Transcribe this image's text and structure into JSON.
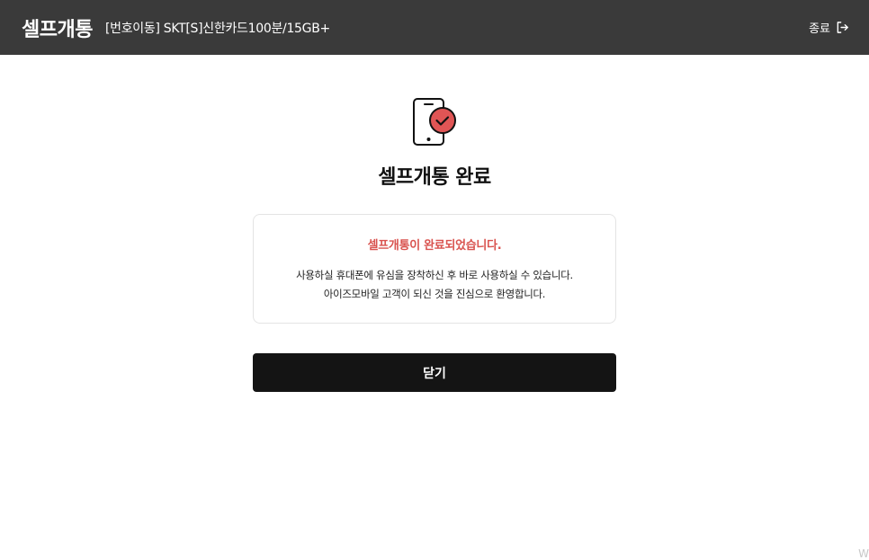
{
  "header": {
    "brand": "셀프개통",
    "plan": "[번호이동] SKT[S]신한카드100분/15GB+",
    "exit_label": "종료"
  },
  "main": {
    "icon": "phone-check-icon",
    "title": "셀프개통 완료",
    "card": {
      "headline": "셀프개통이 완료되었습니다.",
      "line1": "사용하실 휴대폰에 유심을 장착하신 후 바로 사용하실 수 있습니다.",
      "line2": "아이즈모바일 고객이 되신 것을 진심으로 환영합니다."
    },
    "close_label": "닫기"
  },
  "corner_text": "W",
  "colors": {
    "header_bg": "#3a3a3a",
    "accent_red": "#e05555",
    "headline_red": "#d9534f",
    "button_bg": "#141414"
  }
}
